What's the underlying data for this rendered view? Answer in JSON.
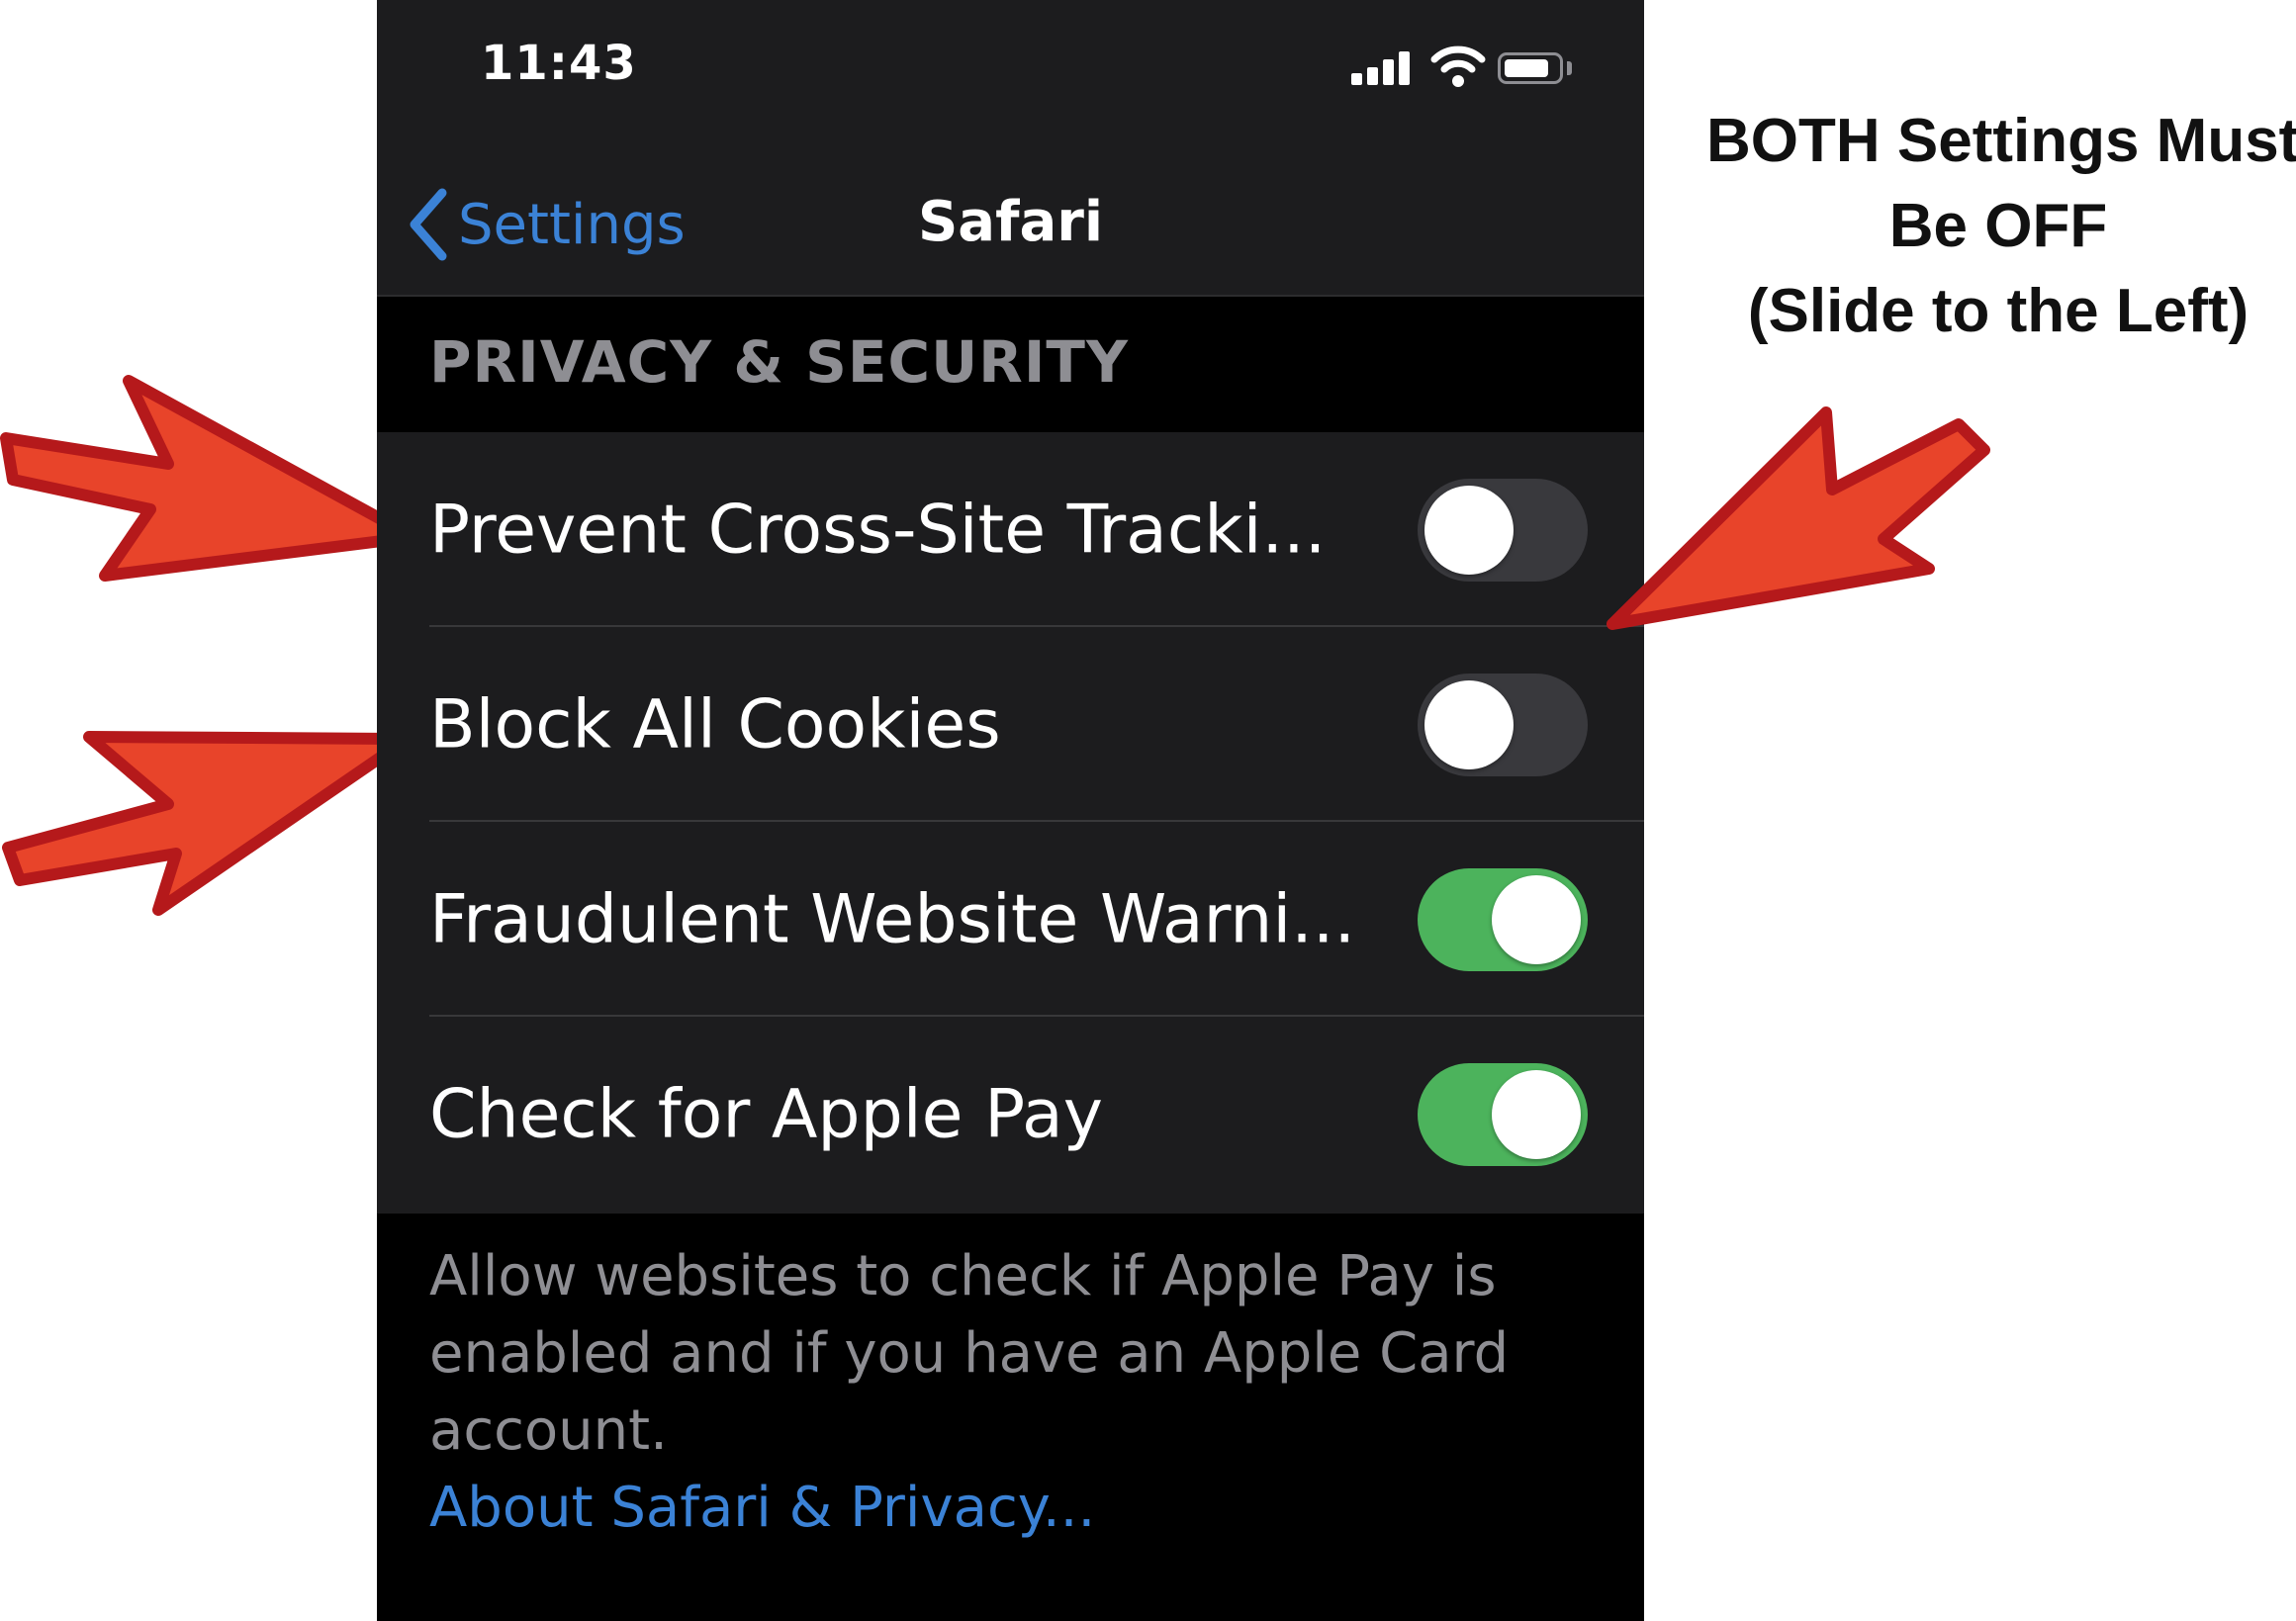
{
  "status_bar": {
    "time": "11:43",
    "icons": [
      "cellular-signal-icon",
      "wifi-icon",
      "battery-icon"
    ]
  },
  "nav_bar": {
    "back_label": "Settings",
    "back_icon": "chevron-left-icon",
    "title": "Safari"
  },
  "section": {
    "header": "PRIVACY & SECURITY",
    "rows": [
      {
        "label": "Prevent Cross-Site Tracki...",
        "enabled": false
      },
      {
        "label": "Block All Cookies",
        "enabled": false
      },
      {
        "label": "Fraudulent Website Warni...",
        "enabled": true
      },
      {
        "label": "Check for Apple Pay",
        "enabled": true
      }
    ],
    "footer_text": "Allow websites to check if Apple Pay is enabled and if you have an Apple Card account.",
    "footer_link": "About Safari & Privacy..."
  },
  "annotation": {
    "lines": [
      "BOTH Settings Must",
      "Be OFF",
      "(Slide to the Left)"
    ],
    "arrow_color": "#e8442a",
    "arrow_outline": "#b5191b"
  },
  "colors": {
    "accent_blue": "#3b82d6",
    "toggle_on": "#4cb35c",
    "toggle_off": "#39393d",
    "background": "#000000",
    "cell_background": "#1c1c1e"
  }
}
